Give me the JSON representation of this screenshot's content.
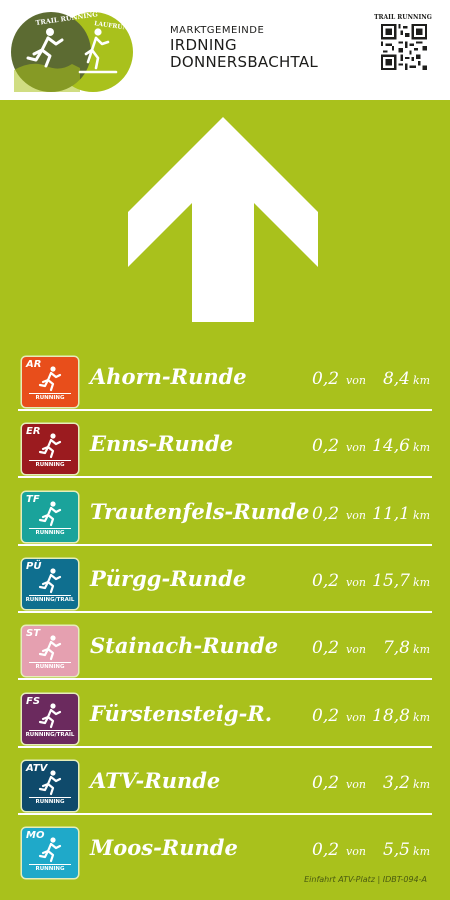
{
  "header": {
    "logo": {
      "left_text": "TRAIL RUNNING",
      "right_text": "LAUFRUNDE",
      "colors": {
        "dark": "#5c6b32",
        "light": "#a9c11c"
      }
    },
    "municipality": {
      "prefix": "MARKTGEMEINDE",
      "line1": "IRDNING",
      "line2": "DONNERSBACHTAL"
    },
    "qr_label": "TRAIL RUNNING"
  },
  "direction": {
    "icon": "arrow-up-icon",
    "color": "#ffffff"
  },
  "distance_prefix": "0,2",
  "von_label": "von",
  "unit_label": "km",
  "routes": [
    {
      "abbr": "AR",
      "name": "Ahorn-Runde",
      "type": "RUNNING",
      "total": "8,4",
      "color": "#e84e1b"
    },
    {
      "abbr": "ER",
      "name": "Enns-Runde",
      "type": "RUNNING",
      "total": "14,6",
      "color": "#9b1b1f"
    },
    {
      "abbr": "TF",
      "name": "Trautenfels-Runde",
      "type": "RUNNING",
      "total": "11,1",
      "color": "#1aa39b"
    },
    {
      "abbr": "PÜ",
      "name": "Pürgg-Runde",
      "type": "RUNNING/TRAIL",
      "total": "15,7",
      "color": "#0f6f8f"
    },
    {
      "abbr": "ST",
      "name": "Stainach-Runde",
      "type": "RUNNING",
      "total": "7,8",
      "color": "#e5a0b0"
    },
    {
      "abbr": "FS",
      "name": "Fürstensteig-R.",
      "type": "RUNNING/TRAIL",
      "total": "18,8",
      "color": "#6b2a5e"
    },
    {
      "abbr": "ATV",
      "name": "ATV-Runde",
      "type": "RUNNING",
      "total": "3,2",
      "color": "#0f4a6b"
    },
    {
      "abbr": "MO",
      "name": "Moos-Runde",
      "type": "RUNNING",
      "total": "5,5",
      "color": "#1fa9c9"
    }
  ],
  "footer": "Einfahrt ATV-Platz | IDBT-094-A"
}
